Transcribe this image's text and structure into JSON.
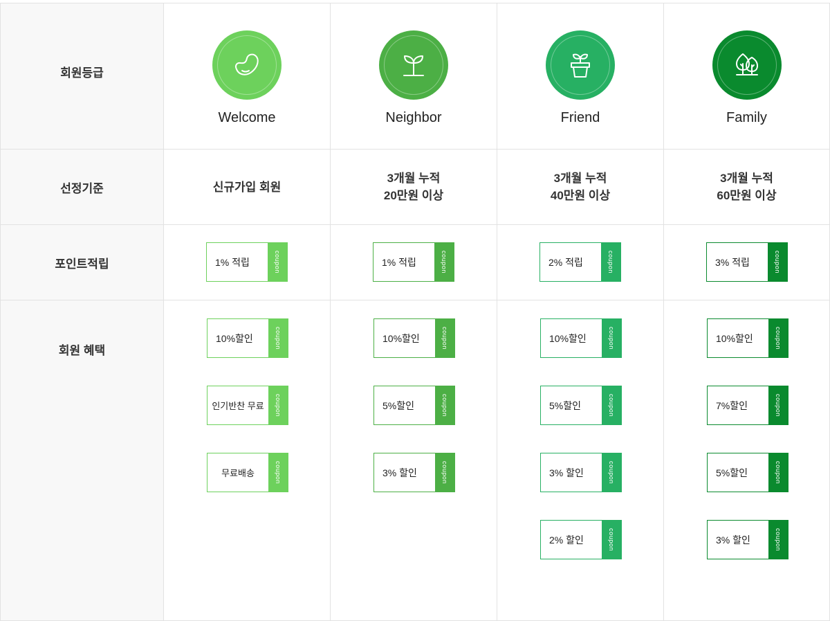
{
  "headers": {
    "grade": "회원등급",
    "criteria": "선정기준",
    "points": "포인트적립",
    "benefits": "회원 혜택"
  },
  "tab_label": "coupon",
  "levels": [
    {
      "name": "Welcome",
      "icon": "bean-icon",
      "color": "#6dd15c",
      "criteria": [
        "신규가입 회원"
      ],
      "points": "1% 적립",
      "benefits": [
        "10%할인",
        "인기반찬 무료",
        "무료배송"
      ]
    },
    {
      "name": "Neighbor",
      "icon": "sprout-icon",
      "color": "#4caf45",
      "criteria": [
        "3개월 누적",
        "20만원 이상"
      ],
      "points": "1% 적립",
      "benefits": [
        "10%할인",
        "5%할인",
        "3% 할인"
      ]
    },
    {
      "name": "Friend",
      "icon": "potted-plant-icon",
      "color": "#27b063",
      "criteria": [
        "3개월 누적",
        "40만원 이상"
      ],
      "points": "2% 적립",
      "benefits": [
        "10%할인",
        "5%할인",
        "3% 할인",
        "2% 할인"
      ]
    },
    {
      "name": "Family",
      "icon": "tree-icon",
      "color": "#0a8a2e",
      "criteria": [
        "3개월 누적",
        "60만원 이상"
      ],
      "points": "3% 적립",
      "benefits": [
        "10%할인",
        "7%할인",
        "5%할인",
        "3% 할인"
      ]
    }
  ]
}
